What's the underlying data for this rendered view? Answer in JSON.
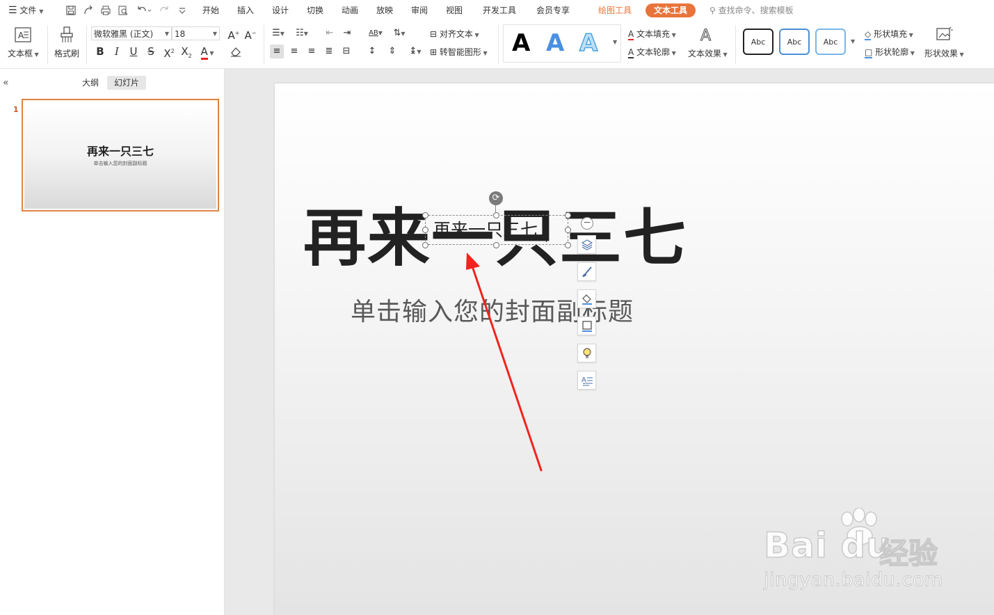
{
  "menu": {
    "file": "文件",
    "tabs": [
      "开始",
      "插入",
      "设计",
      "切换",
      "动画",
      "放映",
      "审阅",
      "视图",
      "开发工具",
      "会员专享"
    ],
    "drawing_tools": "绘图工具",
    "text_tools": "文本工具",
    "search": "查找命令、搜索模板"
  },
  "ribbon": {
    "text_box": "文本框",
    "format_painter": "格式刷",
    "font_name": "微软雅黑 (正文)",
    "font_size": "18",
    "align_text": "对齐文本",
    "smart_art": "转智能图形",
    "text_fill": "文本填充",
    "text_outline": "文本轮廓",
    "text_effect": "文本效果",
    "style_sample": "Abc",
    "shape_fill": "形状填充",
    "shape_outline": "形状轮廓",
    "shape_effect": "形状效果",
    "big_a": "A"
  },
  "panel": {
    "tab_outline": "大纲",
    "tab_slides": "幻灯片",
    "slide_number": "1",
    "thumb_title": "再来一只三七",
    "thumb_subtitle": "单击输入您的封面副标题"
  },
  "slide": {
    "title": "再来一只三七",
    "subtitle": "单击输入您的封面副标题",
    "textbox_text": "再来一只三七"
  },
  "watermark": {
    "brand": "Bai du",
    "brand_cn": "经验",
    "url": "jingyan.baidu.com"
  },
  "colors": {
    "accent": "#e8743b",
    "arrow": "#f2231d"
  }
}
